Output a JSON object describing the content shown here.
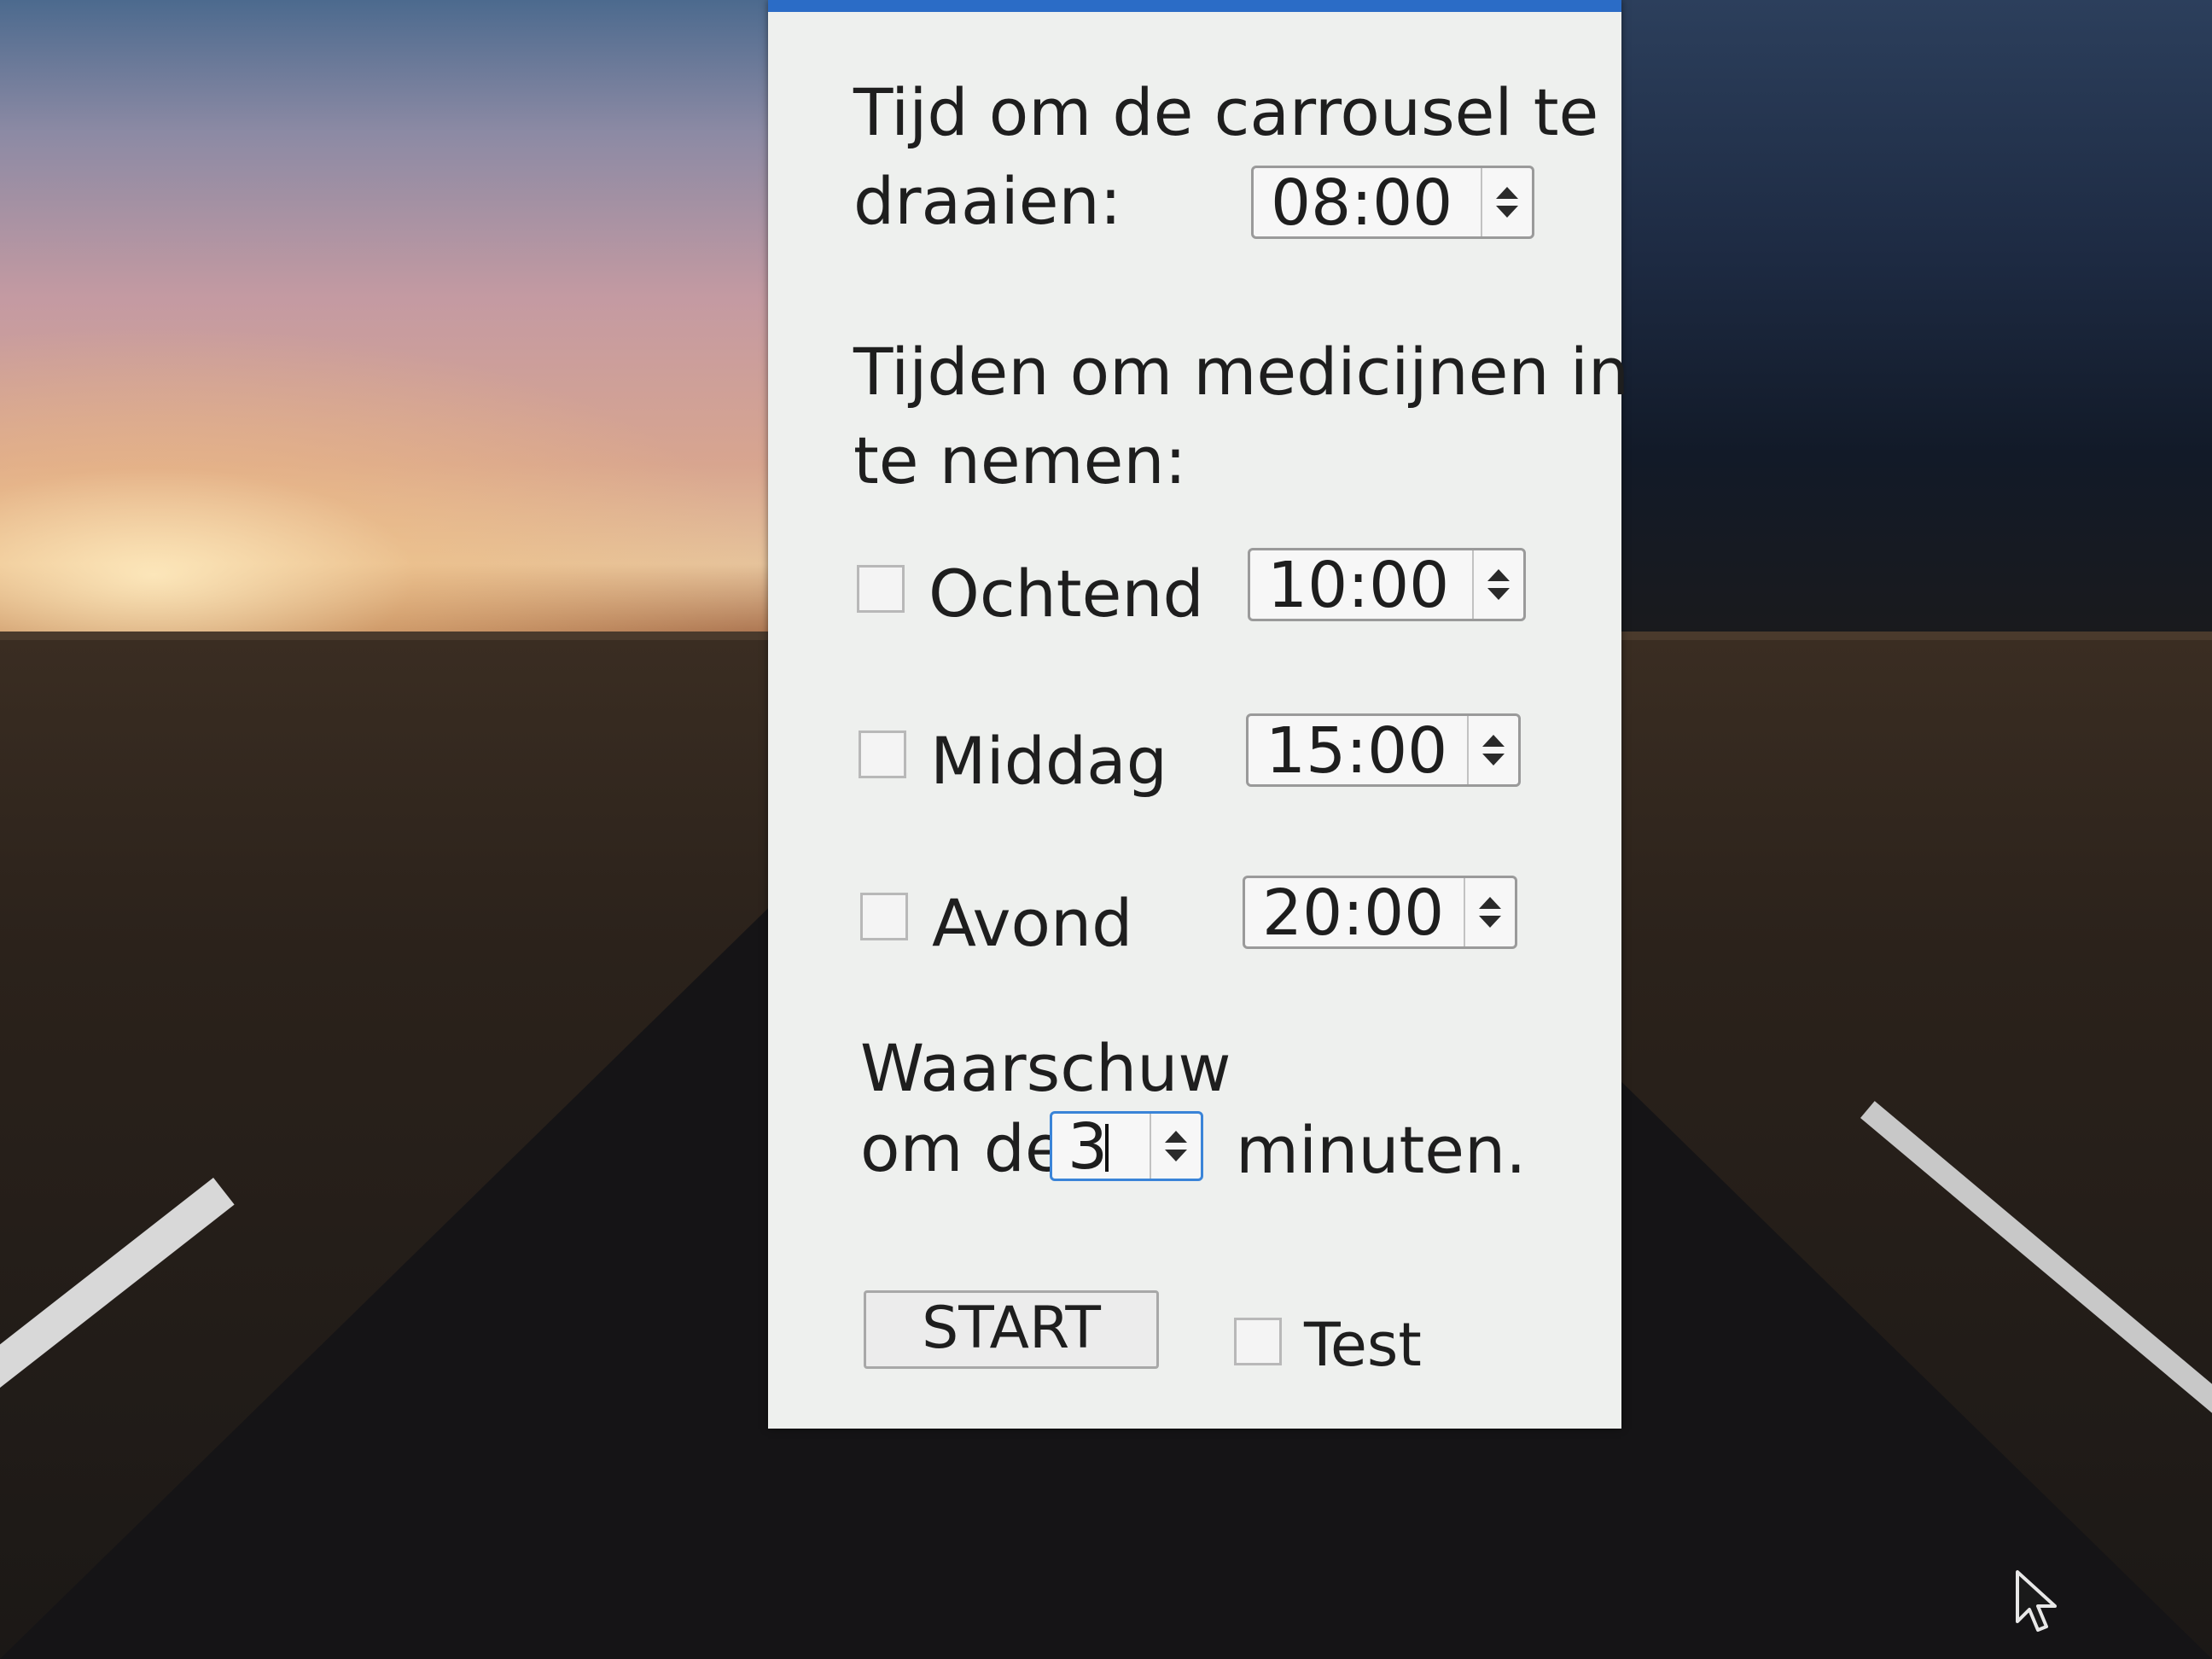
{
  "carousel": {
    "label_line1": "Tijd om de carrousel te",
    "label_line2": "draaien:",
    "time": "08:00"
  },
  "medicines": {
    "label_line1": "Tijden om medicijnen in",
    "label_line2": "te nemen:",
    "slots": [
      {
        "label": "Ochtend",
        "time": "10:00",
        "checked": false
      },
      {
        "label": "Middag",
        "time": "15:00",
        "checked": false
      },
      {
        "label": "Avond",
        "time": "20:00",
        "checked": false
      }
    ]
  },
  "warning": {
    "label_line1": "Waarschuw",
    "label_prefix": "om de",
    "value": "3",
    "label_suffix": "minuten."
  },
  "actions": {
    "start_label": "START",
    "test_label": "Test",
    "test_checked": false
  },
  "colors": {
    "title_bar": "#2b6cc6",
    "dialog_background": "#eef0ee",
    "focus": "#3a84d8"
  }
}
